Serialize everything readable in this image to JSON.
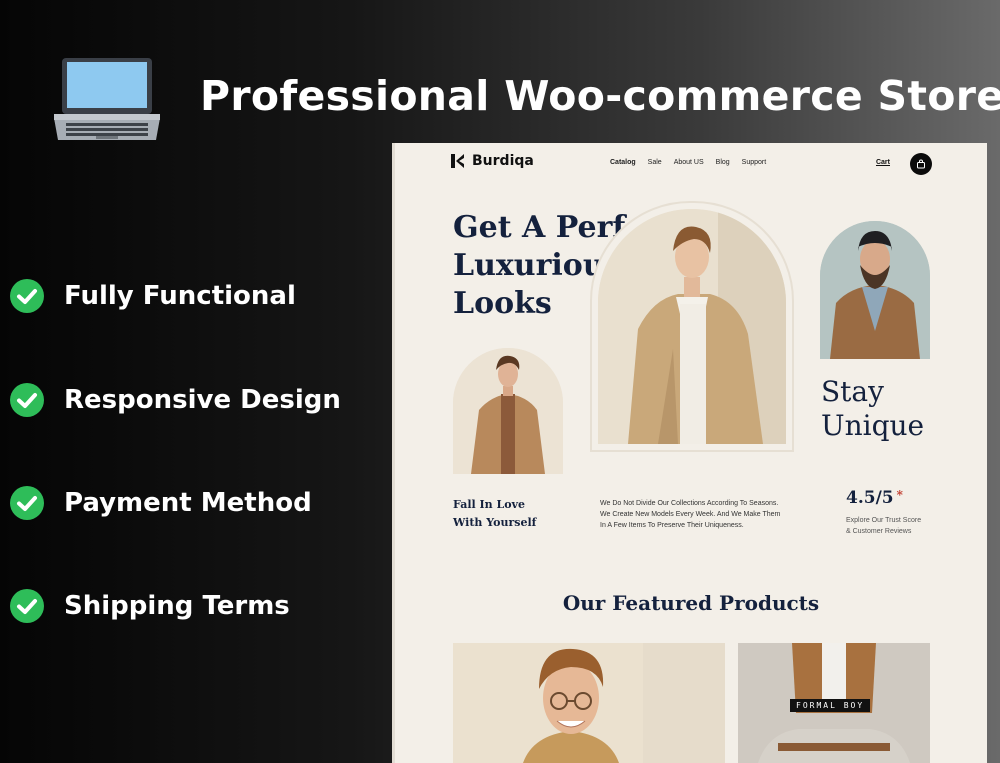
{
  "banner": {
    "title": "Professional Woo-commerce Store",
    "features": [
      "Fully Functional",
      "Responsive Design",
      "Payment Method",
      "Shipping Terms"
    ]
  },
  "site": {
    "brand": "Burdiqa",
    "nav": [
      "Catalog",
      "Sale",
      "About US",
      "Blog",
      "Support"
    ],
    "cart_label": "Cart",
    "hero_lines": [
      "Get A Perfect",
      "Luxurious",
      "Looks"
    ],
    "stay_lines": [
      "Stay",
      "Unique"
    ],
    "fall_lines": [
      "Fall In Love",
      "With Yourself"
    ],
    "description_lines": [
      "We Do Not Divide Our Collections According To Seasons.",
      "We Create New Models Every Week. And We Make Them",
      "In A Few Items To Preserve Their Uniqueness."
    ],
    "rating": "4.5/5",
    "rating_star": "*",
    "rating_sub_lines": [
      "Explore Our Trust Score",
      "& Customer Reviews"
    ],
    "featured_heading": "Our Featured Products",
    "product_badge": "FORMAL BOY"
  },
  "colors": {
    "check_green": "#2ebd59",
    "site_bg": "#f3efe8",
    "navy": "#14213d"
  }
}
